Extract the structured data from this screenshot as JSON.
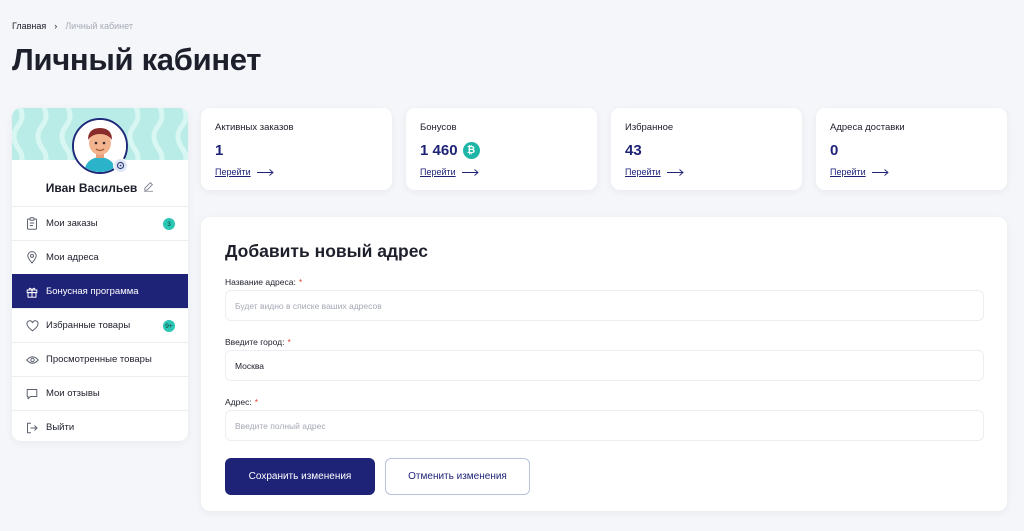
{
  "breadcrumb": {
    "home": "Главная",
    "separator": "›",
    "current": "Личный кабинет"
  },
  "page": {
    "title": "Личный кабинет"
  },
  "profile": {
    "name": "Иван Васильев"
  },
  "menu": [
    {
      "label": "Мои заказы",
      "icon": "clipboard-icon",
      "badge": "3",
      "active": false
    },
    {
      "label": "Мои адреса",
      "icon": "location-pin-icon",
      "badge": null,
      "active": false
    },
    {
      "label": "Бонусная программа",
      "icon": "gift-icon",
      "badge": null,
      "active": true
    },
    {
      "label": "Избранные товары",
      "icon": "heart-icon",
      "badge": "9+",
      "active": false
    },
    {
      "label": "Просмотренные товары",
      "icon": "eye-icon",
      "badge": null,
      "active": false
    },
    {
      "label": "Мои отзывы",
      "icon": "chat-icon",
      "badge": null,
      "active": false
    },
    {
      "label": "Выйти",
      "icon": "logout-icon",
      "badge": null,
      "active": false
    }
  ],
  "stats": [
    {
      "label": "Активных заказов",
      "value": "1",
      "link": "Перейти"
    },
    {
      "label": "Бонусов",
      "value": "1 460",
      "coin": "₿",
      "link": "Перейти"
    },
    {
      "label": "Избранное",
      "value": "43",
      "link": "Перейти"
    },
    {
      "label": "Адреса доставки",
      "value": "0",
      "link": "Перейти"
    }
  ],
  "form": {
    "title": "Добавить новый адрес",
    "required_mark": "*",
    "fields": [
      {
        "label": "Название адреса:",
        "value": "",
        "placeholder": "Будет видно в списке ваших адресов"
      },
      {
        "label": "Введите город:",
        "value": "Москва",
        "placeholder": ""
      },
      {
        "label": "Адрес:",
        "value": "",
        "placeholder": "Введите полный адрес"
      }
    ],
    "save_label": "Сохранить изменения",
    "cancel_label": "Отменить изменения"
  },
  "colors": {
    "accent": "#1f2378",
    "teal": "#2bc6b4",
    "required": "#e2412b",
    "background": "#f4f6f9"
  }
}
